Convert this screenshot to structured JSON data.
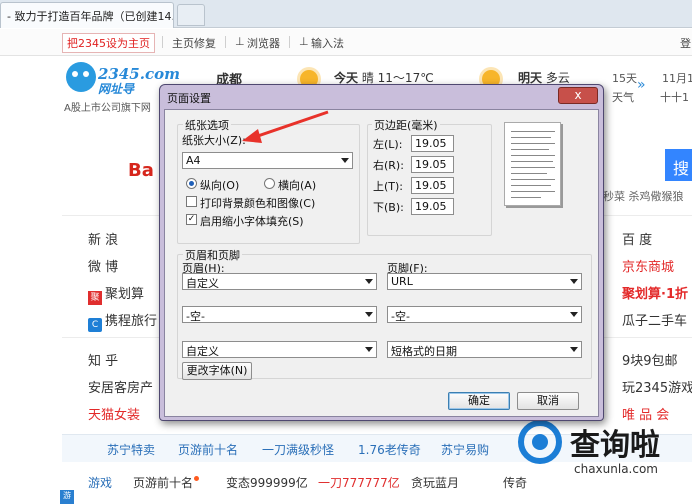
{
  "browser": {
    "tab_title": "- 致力于打造百年品牌（已创建14..."
  },
  "topbar": {
    "set_home": "把2345设为主页",
    "home_fix": "主页修复",
    "browser": "浏览器",
    "input_method": "输入法",
    "login": "登"
  },
  "header": {
    "logo_text": "2345.com",
    "logo_sub": "网址导",
    "slogan": "A股上市公司旗下网",
    "city": "成都",
    "today": {
      "label": "今天",
      "desc": "晴 11～17℃"
    },
    "tomorrow": {
      "label": "明天",
      "desc": "多云"
    },
    "extra1": "15天",
    "extra2": "天气",
    "date1": "11月1",
    "date2": "十十1"
  },
  "search": {
    "engine": "Ba",
    "button": "搜",
    "hotwords": "秒菜  杀鸡儆猴狼"
  },
  "sites": {
    "left": [
      "新 浪",
      "微 博",
      "聚划算",
      "携程旅行",
      "知 乎",
      "安居客房产",
      "天猫女装"
    ],
    "right": [
      "百 度",
      "京东商城",
      "聚划算·1折",
      "瓜子二手车",
      "9块9包邮",
      "玩2345游戏",
      "唯 品 会"
    ]
  },
  "categories": [
    "苏宁特卖",
    "页游前十名",
    "一刀满级秒怪",
    "1.76老传奇",
    "苏宁易购"
  ],
  "bottom": [
    "游戏",
    "页游前十名",
    "变态999999亿",
    "一刀777777亿",
    "贪玩蓝月",
    "传奇"
  ],
  "watermark": {
    "main": "查询啦",
    "sub": "chaxunla.com"
  },
  "dialog": {
    "title": "页面设置",
    "close": "x",
    "paper_group": "纸张选项",
    "paper_size_label": "纸张大小(Z):",
    "paper_size": "A4",
    "portrait": "纵向(O)",
    "landscape": "横向(A)",
    "print_bg": "打印背景颜色和图像(C)",
    "shrink": "启用缩小字体填充(S)",
    "margin_group": "页边距(毫米)",
    "margins": [
      {
        "label": "左(L):",
        "value": "19.05"
      },
      {
        "label": "右(R):",
        "value": "19.05"
      },
      {
        "label": "上(T):",
        "value": "19.05"
      },
      {
        "label": "下(B):",
        "value": "19.05"
      }
    ],
    "hf_group": "页眉和页脚",
    "header_label": "页眉(H):",
    "footer_label": "页脚(F):",
    "header_values": [
      "自定义",
      "-空-",
      "自定义"
    ],
    "footer_values": [
      "URL",
      "-空-",
      "短格式的日期"
    ],
    "change_font": "更改字体(N)",
    "ok": "确定",
    "cancel": "取消",
    "portrait_selected": true,
    "print_bg_checked": false,
    "shrink_checked": true
  }
}
